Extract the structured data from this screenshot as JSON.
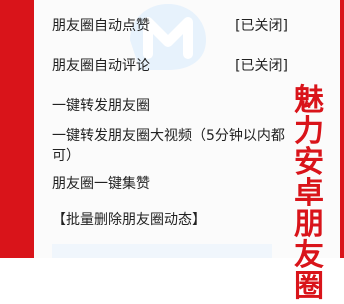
{
  "list": {
    "items": [
      {
        "label": "朋友圈自动点赞",
        "status": "[已关闭]"
      },
      {
        "label": "朋友圈自动评论",
        "status": "[已关闭]"
      },
      {
        "label": "一键转发朋友圈"
      },
      {
        "label": "一键转发朋友圈大视频（5分钟以内都可）"
      },
      {
        "label": "朋友圈一键集赞"
      },
      {
        "label": "【批量删除朋友圈动态】"
      }
    ]
  },
  "overlay": {
    "vertical_text": [
      "魅",
      "力",
      "安",
      "卓",
      "朋",
      "友",
      "圈"
    ],
    "color": "#d9141a"
  },
  "icons": {
    "watermark": "app-logo-watermark-icon"
  }
}
